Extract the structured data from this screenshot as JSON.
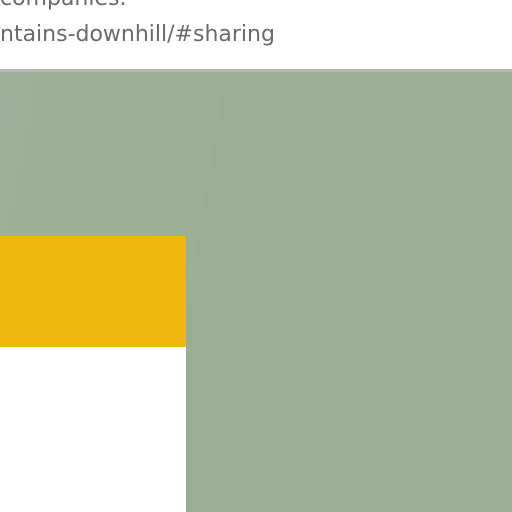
{
  "top_bar": {
    "line1": "companies.",
    "line2": "ntains-downhill/#sharing"
  },
  "colors": {
    "background": "#9aae95",
    "accent": "#efb60d",
    "panel": "#ffffff",
    "text": "#6a6a6a"
  }
}
